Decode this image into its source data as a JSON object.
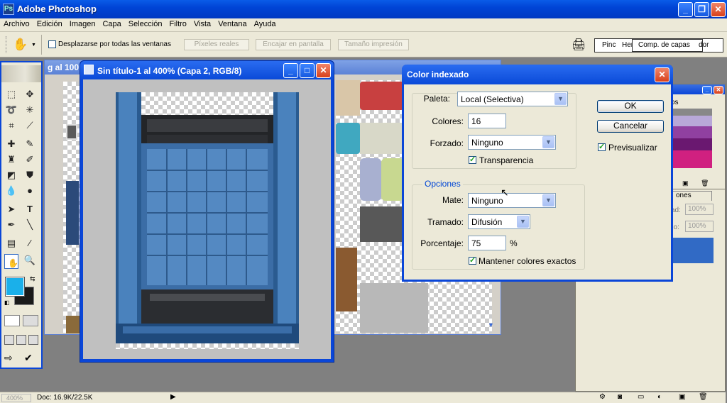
{
  "app": {
    "title": "Adobe Photoshop"
  },
  "menu": [
    "Archivo",
    "Edición",
    "Imagen",
    "Capa",
    "Selección",
    "Filtro",
    "Vista",
    "Ventana",
    "Ayuda"
  ],
  "options_bar": {
    "scroll_all_label": "Desplazarse por todas las ventanas",
    "actual_pixels": "Píxeles reales",
    "fit_screen": "Encajar en pantalla",
    "print_size": "Tamaño impresión",
    "palette_well_tabs": [
      "Pinc",
      "Herr",
      "Comp. de capas",
      "dor"
    ]
  },
  "background_document": {
    "title": "g al 100"
  },
  "document": {
    "title": "Sin título-1 al 400% (Capa 2, RGB/8)"
  },
  "dialog": {
    "title": "Color indexado",
    "paleta_label": "Paleta:",
    "paleta_value": "Local (Selectiva)",
    "colores_label": "Colores:",
    "colores_value": "16",
    "forzado_label": "Forzado:",
    "forzado_value": "Ninguno",
    "transparencia_label": "Transparencia",
    "opciones_legend": "Opciones",
    "mate_label": "Mate:",
    "mate_value": "Ninguno",
    "tramado_label": "Tramado:",
    "tramado_value": "Difusión",
    "porcentaje_label": "Porcentaje:",
    "porcentaje_value": "75",
    "porcentaje_unit": "%",
    "mantener_label": "Mantener colores exactos",
    "ok": "OK",
    "cancelar": "Cancelar",
    "previsualizar": "Previsualizar"
  },
  "layers_panel": {
    "tab_partial": "ones",
    "opacity_label_partial": "ad:",
    "opacity_value": "100%",
    "fill_label_partial": "no:",
    "fill_value": "100%"
  },
  "swatches_panel": {
    "tab_partial": "os"
  },
  "status_bar": {
    "zoom": "400%",
    "doc_info": "Doc: 16.9K/22.5K"
  },
  "colors": {
    "foreground": "#1ab0ea",
    "background": "#1a1a1a",
    "xp_blue": "#0a46d8"
  }
}
